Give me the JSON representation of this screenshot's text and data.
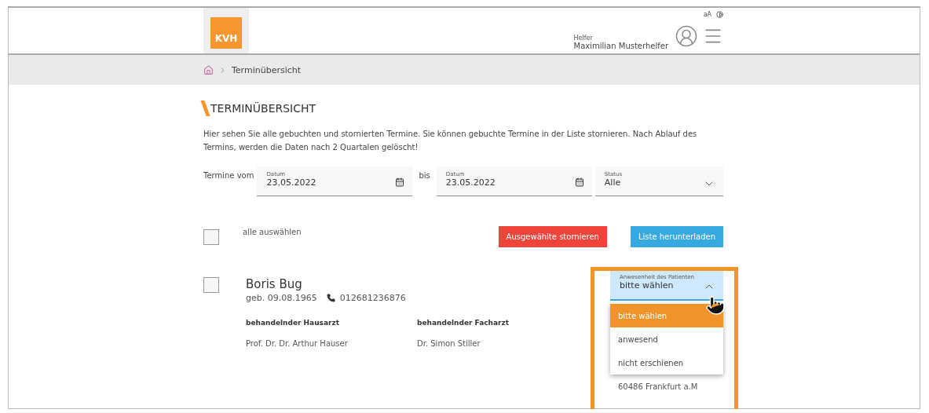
{
  "header": {
    "logo": "KVH",
    "text_size": "aA",
    "role": "Helfer",
    "user": "Maximilian Musterhelfer"
  },
  "breadcrumb": {
    "current": "Terminübersicht"
  },
  "title": "TERMINÜBERSICHT",
  "intro": "Hier sehen Sie alle gebuchten und stornierten Termine. Sie können gebuchte Termine in der Liste stornieren. Nach Ablauf des Termins, werden die Daten nach 2 Quartalen gelöscht!",
  "filter": {
    "from_label": "Termine vom",
    "to_label": "bis",
    "from": {
      "label": "Datum",
      "value": "23.05.2022"
    },
    "to": {
      "label": "Datum",
      "value": "23.05.2022"
    },
    "status": {
      "label": "Status",
      "value": "Alle"
    }
  },
  "select_all": {
    "label": "alle auswählen",
    "checked": false
  },
  "buttons": [
    {
      "label": "Ausgewählte stornieren",
      "kind": "danger"
    },
    {
      "label": "Liste herunterladen",
      "kind": "primary"
    }
  ],
  "appointments": [
    {
      "checked": false,
      "name": "Boris Bug",
      "born": "geb. 09.08.1965",
      "phone": "012681236876",
      "gp_label": "behandelnder Hausarzt",
      "gp": "Prof. Dr. Dr. Arthur Hauser",
      "specialist_label": "behandelnder Facharzt",
      "specialist": "Dr. Simon Stiller",
      "address": "60486 Frankfurt a.M",
      "attendance": {
        "label": "Anwesenheit des Patienten",
        "value": "bitte wählen",
        "expanded": true,
        "options": [
          {
            "label": "bitte wählen",
            "selected": true
          },
          {
            "label": "anwesend",
            "selected": false
          },
          {
            "label": "nicht erschienen",
            "selected": false
          }
        ]
      }
    }
  ]
}
